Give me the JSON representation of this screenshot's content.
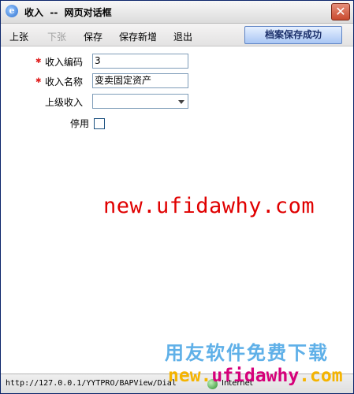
{
  "window": {
    "title": "收入  --  网页对话框",
    "icon": "ie-page-icon",
    "close_label": "✕"
  },
  "toolbar": {
    "items": [
      {
        "label": "上张",
        "enabled": true
      },
      {
        "label": "下张",
        "enabled": false
      },
      {
        "label": "保存",
        "enabled": true
      },
      {
        "label": "保存新增",
        "enabled": true
      },
      {
        "label": "退出",
        "enabled": true
      }
    ],
    "toast": "档案保存成功"
  },
  "form": {
    "code_label": "收入编码",
    "code_value": "3",
    "name_label": "收入名称",
    "name_value": "变卖固定资产",
    "parent_label": "上级收入",
    "parent_value": "",
    "disabled_label": "停用",
    "disabled_checked": false
  },
  "watermarks": {
    "center": "new.ufidawhy.com",
    "cn": "用友软件免费下载",
    "url_part1": "new.",
    "url_part2": "ufidawhy",
    "url_part3": ".com"
  },
  "status": {
    "url": "http://127.0.0.1/YYTPRO/BAPView/Dial",
    "zone": "Internet"
  }
}
